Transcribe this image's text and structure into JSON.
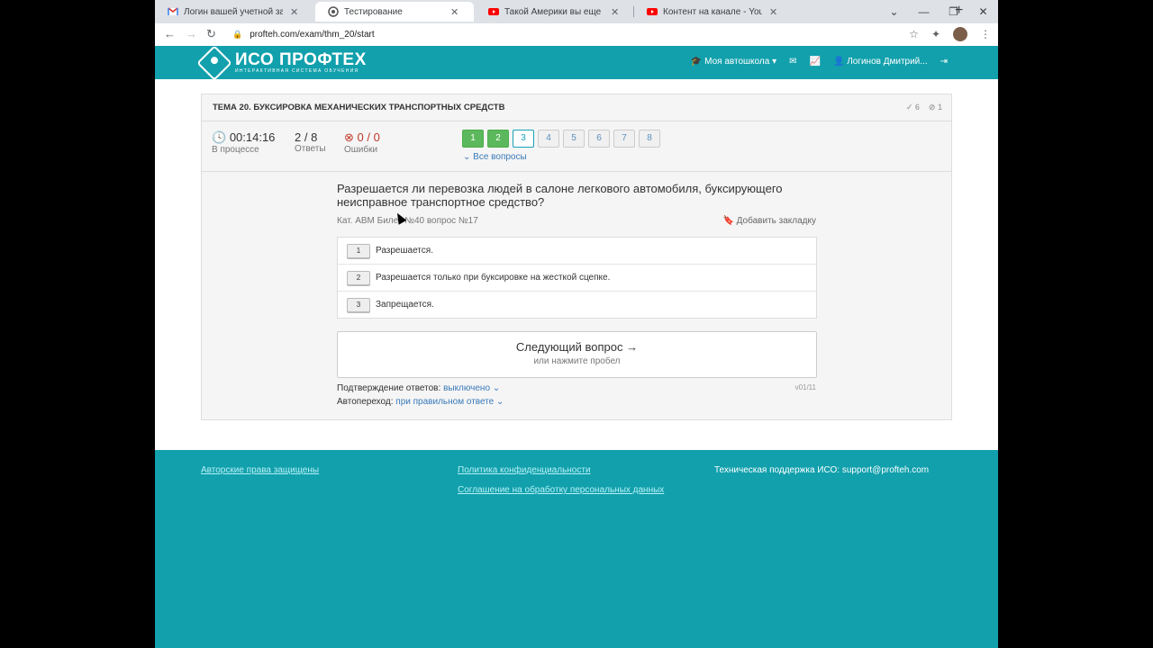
{
  "browser": {
    "tabs": [
      {
        "title": "Логин вашей учетной записи б",
        "icon": "gmail-icon"
      },
      {
        "title": "Тестирование",
        "icon": "site-icon"
      },
      {
        "title": "Такой Америки вы еще не видє",
        "icon": "youtube-icon"
      },
      {
        "title": "Контент на канале - YouTube St",
        "icon": "youtube-icon"
      }
    ],
    "new_tab": "+",
    "url": "profteh.com/exam/thm_20/start"
  },
  "header": {
    "logo_title": "ИСО ПРОФТЕХ",
    "logo_subtitle": "ИНТЕРАКТИВНАЯ СИСТЕМА ОБУЧЕНИЯ",
    "school_menu": "Моя автошкола",
    "user_name": "Логинов Дмитрий..."
  },
  "topic": {
    "title": "ТЕМА 20. БУКСИРОВКА МЕХАНИЧЕСКИХ ТРАНСПОРТНЫХ СРЕДСТВ",
    "correct_count": "6",
    "wrong_count": "1"
  },
  "stats": {
    "time": "00:14:16",
    "time_label": "В процессе",
    "answers": "2 / 8",
    "answers_label": "Ответы",
    "errors": "0 / 0",
    "errors_label": "Ошибки"
  },
  "question_numbers": [
    "1",
    "2",
    "3",
    "4",
    "5",
    "6",
    "7",
    "8"
  ],
  "all_questions_label": "Все вопросы",
  "question": {
    "text": "Разрешается ли перевозка людей в салоне легкового автомобиля, буксирующего неисправное транспортное средство?",
    "meta": "Кат. ABM  Билет №40  вопрос №17",
    "bookmark": "Добавить закладку"
  },
  "answers": [
    {
      "num": "1",
      "text": "Разрешается."
    },
    {
      "num": "2",
      "text": "Разрешается только при буксировке на жесткой сцепке."
    },
    {
      "num": "3",
      "text": "Запрещается."
    }
  ],
  "next_button": {
    "title": "Следующий вопрос →",
    "hint": "или нажмите пробел"
  },
  "options": {
    "confirm_label": "Подтверждение ответов:",
    "confirm_value": "выключено",
    "auto_label": "Автопереход:",
    "auto_value": "при правильном ответе",
    "version": "v01/11"
  },
  "footer": {
    "copyright": "Авторские права защищены",
    "privacy": "Политика конфиденциальности",
    "agreement": "Соглашение на обработку персональных данных",
    "support": "Техническая поддержка ИСО:  support@profteh.com"
  }
}
